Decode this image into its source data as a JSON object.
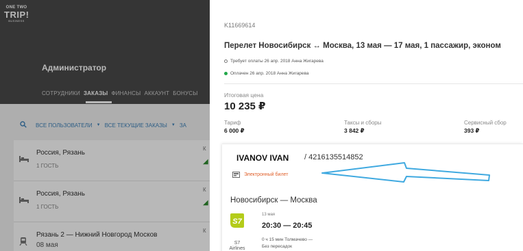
{
  "brand": {
    "logo_line1": "ONE TWO",
    "logo_line2": "TRIP!",
    "logo_line3": "BUSINESS"
  },
  "admin": {
    "title": "Администратор",
    "nav": [
      {
        "label": "СОТРУДНИКИ",
        "active": false
      },
      {
        "label": "ЗАКАЗЫ",
        "active": true
      },
      {
        "label": "ФИНАНСЫ",
        "active": false
      },
      {
        "label": "АККАУНТ",
        "active": false
      },
      {
        "label": "БОНУСЫ",
        "active": false
      }
    ],
    "filters": {
      "users": "ВСЕ ПОЛЬЗОВАТЕЛИ",
      "orders": "ВСЕ ТЕКУЩИЕ ЗАКАЗЫ",
      "extra": "ЗА"
    },
    "orders": [
      {
        "route": "Россия, Рязань",
        "sub": "1 ГОСТЬ",
        "edge": "К"
      },
      {
        "route": "Россия, Рязань",
        "sub": "1 ГОСТЬ",
        "edge": "К"
      },
      {
        "route": "Рязань 2 — Нижний Новгород Москов",
        "sub": "08 мая",
        "edge": "К"
      }
    ]
  },
  "detail": {
    "order_id": "K11669614",
    "title": "Перелет Новосибирск ↔ Москва, 13 мая — 17 мая, 1 пассажир, эконом",
    "status_pending": "Требует оплаты 26 апр. 2018 Анна Жигарева",
    "status_paid": "Оплачен 26 апр. 2018 Анна Жигарева",
    "total_label": "Итоговая цена",
    "total_value": "10 235 ₽",
    "fees": [
      {
        "label": "Тариф",
        "value": "6 000 ₽"
      },
      {
        "label": "Таксы и сборы",
        "value": "3 842 ₽"
      },
      {
        "label": "Сервисный сбор",
        "value": "393 ₽"
      }
    ],
    "passenger": {
      "name": "IVANOV IVAN",
      "document": "/ 4216135514852"
    },
    "eticket_label": "Электронный билет",
    "route": "Новосибирск — Москва",
    "flight": {
      "airline_logo_text": "S7",
      "airline_name": "S7 Airlines",
      "date": "13 мая",
      "times": "20:30 — 20:45",
      "duration": "0 ч 15 мин Толмачево —",
      "stops": "Без пересадок"
    }
  },
  "colors": {
    "accent_blue": "#3f82b9",
    "paid_green": "#22a84a",
    "eticket_orange": "#e0612c",
    "annotation_arrow": "#3fa9e0",
    "s7_green": "#b4cc1a"
  }
}
